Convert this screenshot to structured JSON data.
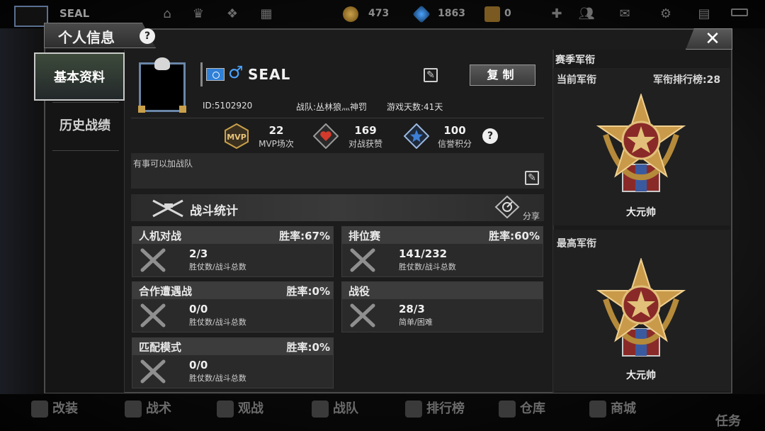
{
  "top_hud": {
    "player_name": "SEAL",
    "currencies": [
      {
        "icon": "gold-coin-icon",
        "value": "473"
      },
      {
        "icon": "diamond-icon",
        "value": "1863"
      },
      {
        "icon": "ticket-icon",
        "value": "0"
      }
    ],
    "icons": [
      "home-icon",
      "crown-icon",
      "gift-icon",
      "grid-icon",
      "plus-icon",
      "friends-icon",
      "mail-icon",
      "gear-icon",
      "book-icon",
      "battery-icon"
    ]
  },
  "window": {
    "title": "个人信息",
    "help": "?",
    "close": "✕"
  },
  "nav": {
    "items": [
      {
        "label": "基本资料",
        "active": true
      },
      {
        "label": "历史战绩",
        "active": false
      }
    ]
  },
  "profile": {
    "name": "SEAL",
    "gender_symbol": "♂",
    "copy_label": "复制",
    "id_text": "ID:5102920",
    "clan_text": "战队:丛林狼灬神罚",
    "days_text": "游戏天数:41天",
    "stats": [
      {
        "icon": "mvp-icon",
        "value": "22",
        "label": "MVP场次"
      },
      {
        "icon": "heart-icon",
        "value": "169",
        "label": "对战获赞"
      },
      {
        "icon": "star-icon",
        "value": "100",
        "label": "信誉积分"
      }
    ],
    "stats_help": "?",
    "motto": "有事可以加战队"
  },
  "battle": {
    "title": "战斗统计",
    "share_label": "分享",
    "cards": [
      {
        "title": "人机对战",
        "rate": "胜率:67%",
        "value": "2/3",
        "sub": "胜仗数/战斗总数"
      },
      {
        "title": "排位赛",
        "rate": "胜率:60%",
        "value": "141/232",
        "sub": "胜仗数/战斗总数"
      },
      {
        "title": "合作遭遇战",
        "rate": "胜率:0%",
        "value": "0/0",
        "sub": "胜仗数/战斗总数"
      },
      {
        "title": "战役",
        "rate": "",
        "value": "28/3",
        "sub": "简单/困难"
      },
      {
        "title": "匹配模式",
        "rate": "胜率:0%",
        "value": "0/0",
        "sub": "胜仗数/战斗总数"
      }
    ]
  },
  "rank": {
    "title": "赛季军衔",
    "current_label": "当前军衔",
    "leaderboard": "军衔排行榜:28",
    "current_rank": "大元帅",
    "highest_label": "最高军衔",
    "highest_rank": "大元帅"
  },
  "bottom_nav": {
    "items": [
      {
        "label": "改装"
      },
      {
        "label": "战术"
      },
      {
        "label": "观战"
      },
      {
        "label": "战队"
      },
      {
        "label": "排行榜"
      },
      {
        "label": "仓库"
      },
      {
        "label": "商城"
      },
      {
        "label": "任务"
      }
    ]
  },
  "colors": {
    "accent_blue": "#4aa3ff",
    "gold": "#c9a04a",
    "heart_red": "#d33a2c",
    "star_blue": "#3d7fd6"
  }
}
